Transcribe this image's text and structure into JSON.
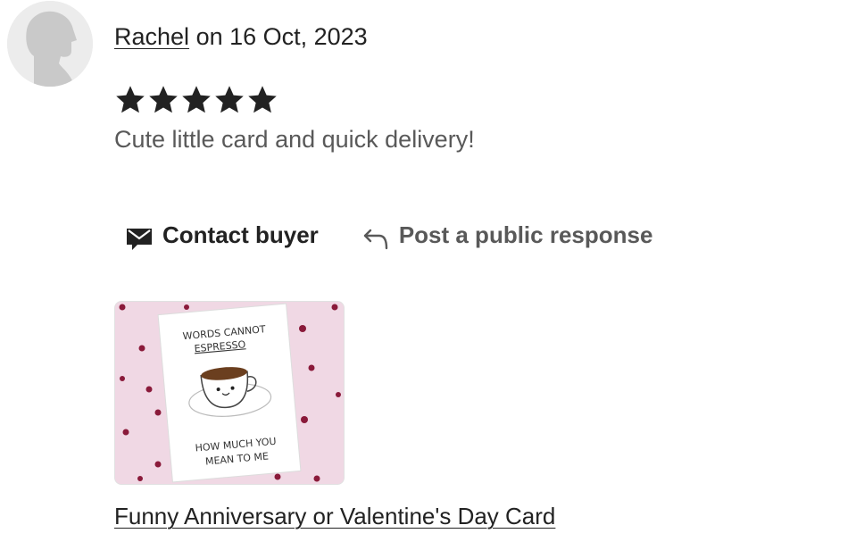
{
  "review": {
    "reviewer_name": "Rachel",
    "date_text": "on 16 Oct, 2023",
    "rating": 5,
    "rating_max": 5,
    "text": "Cute little card and quick delivery!"
  },
  "actions": {
    "contact_label": "Contact buyer",
    "contact_icon": "envelope-icon",
    "respond_label": "Post a public response",
    "respond_icon": "reply-arrow-icon"
  },
  "listing": {
    "title": "Funny Anniversary or Valentine's Day Card",
    "card_text_top": "WORDS CANNOT",
    "card_text_top2": "ESPRESSO",
    "card_text_bottom": "HOW MUCH YOU",
    "card_text_bottom2": "MEAN TO ME"
  },
  "colors": {
    "text": "#222222",
    "muted": "#595959",
    "thumb_bg": "#f0d8e4",
    "heart": "#8a1a3a"
  }
}
